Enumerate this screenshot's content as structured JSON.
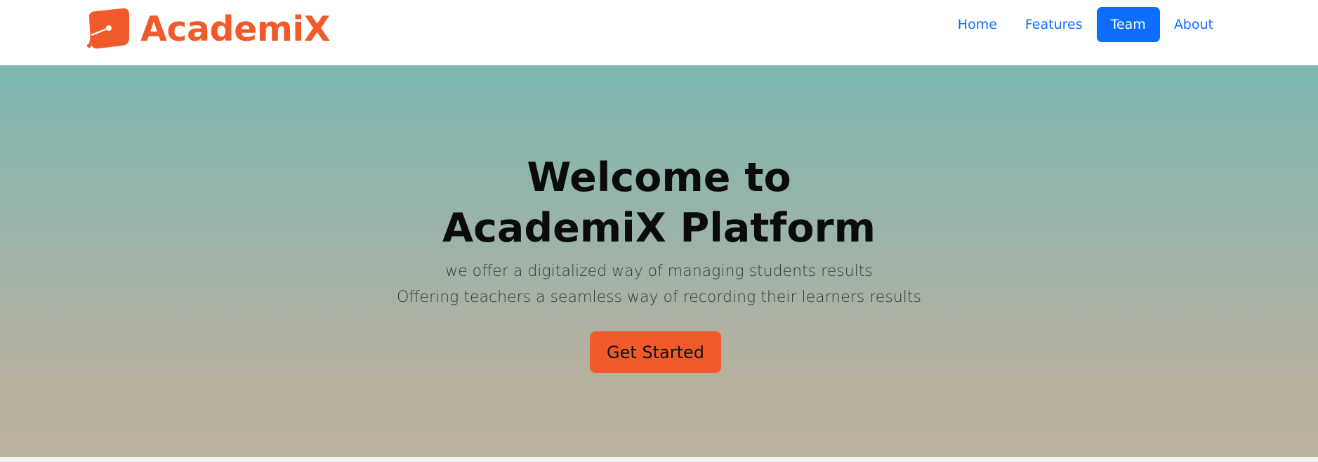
{
  "brand": {
    "name": "AcademiX",
    "logo_icon": "academix-logo-icon",
    "color": "#f15a2b"
  },
  "nav": {
    "items": [
      {
        "label": "Home",
        "active": false
      },
      {
        "label": "Features",
        "active": false
      },
      {
        "label": "Team",
        "active": true
      },
      {
        "label": "About",
        "active": false
      }
    ],
    "link_color": "#0d6efd",
    "active_bg": "#0d6efd"
  },
  "hero": {
    "title_line1": "Welcome to",
    "title_line2": "AcademiX Platform",
    "subtitle_line1": "we offer a digitalized way of managing students results",
    "subtitle_line2": "Offering teachers a seamless way of recording their learners results",
    "cta_label": "Get Started",
    "cta_color": "#f15a2b",
    "gradient_top": "#7cb8b1",
    "gradient_bottom": "#bab19e"
  }
}
